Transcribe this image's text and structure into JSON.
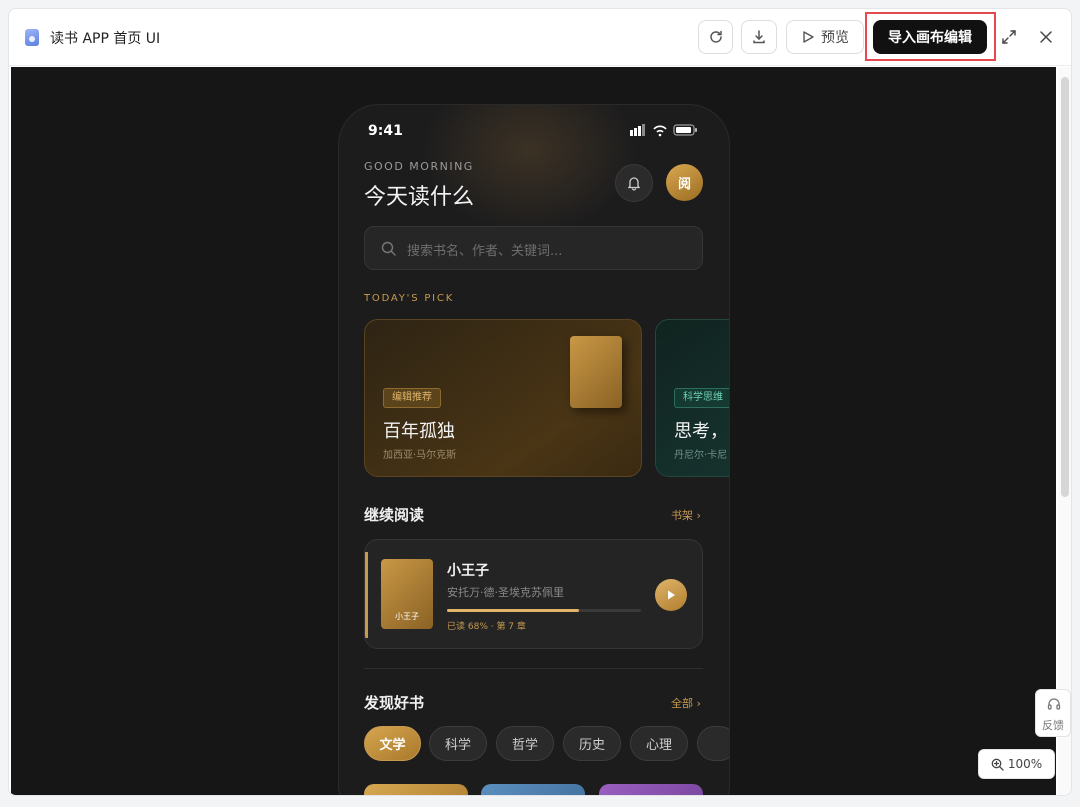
{
  "window": {
    "title": "读书 APP 首页 UI",
    "preview_label": "预览",
    "import_label": "导入画布编辑"
  },
  "phone": {
    "status_time": "9:41",
    "greeting": "GOOD MORNING",
    "headline": "今天读什么",
    "avatar_text": "阅",
    "search_placeholder": "搜索书名、作者、关键词...",
    "todays_pick_label": "TODAY'S PICK",
    "picks": [
      {
        "tag": "编辑推荐",
        "title": "百年孤独",
        "author": "加西亚·马尔克斯"
      },
      {
        "tag": "科学思维",
        "title": "思考，",
        "author": "丹尼尔·卡尼"
      }
    ],
    "continue_section": {
      "title": "继续阅读",
      "link": "书架 ›",
      "book_cover_text": "小王子",
      "book_title": "小王子",
      "book_author": "安托万·德·圣埃克苏佩里",
      "progress": 0.68,
      "progress_text": "已读 68% · 第 7 章"
    },
    "discover_section": {
      "title": "发现好书",
      "link": "全部 ›",
      "categories": [
        "文学",
        "科学",
        "哲学",
        "历史",
        "心理"
      ]
    }
  },
  "feedback_label": "反馈",
  "zoom_level": "100%",
  "colors": {
    "accent_gold": "#c79a4f",
    "import_button": "#111111",
    "highlight_red": "#e5484d",
    "canvas_bg": "#161616"
  }
}
